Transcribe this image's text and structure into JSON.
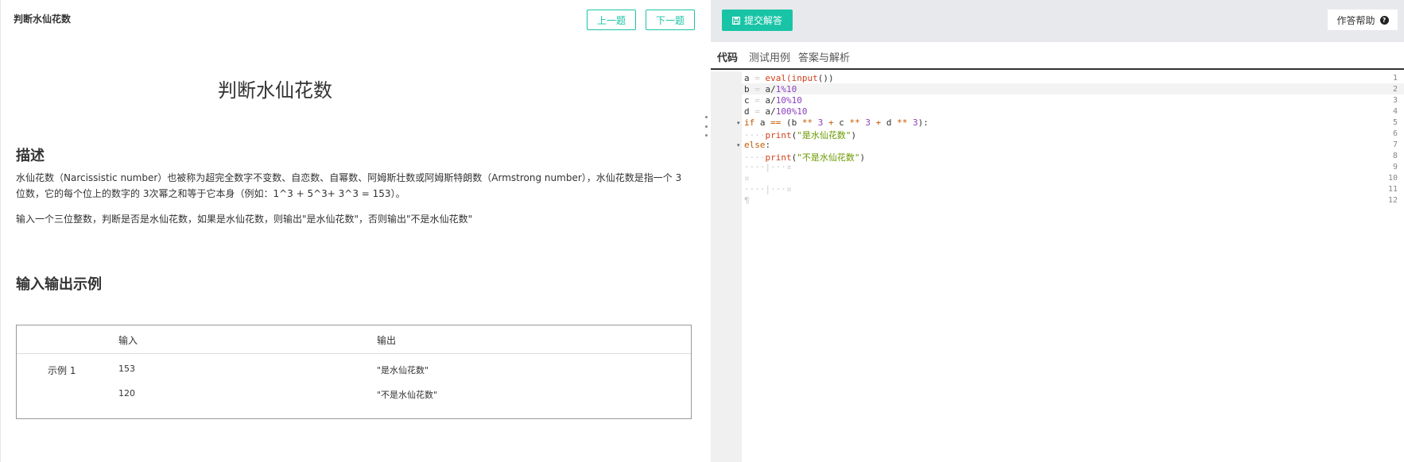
{
  "problem": {
    "header_title": "判断水仙花数",
    "prev_label": "上一题",
    "next_label": "下一题",
    "main_title": "判断水仙花数",
    "desc_heading": "描述",
    "desc_p1": "水仙花数（Narcissistic number）也被称为超完全数字不变数、自恋数、自幂数、阿姆斯壮数或阿姆斯特朗数（Armstrong number），水仙花数是指一个 3 位数，它的每个位上的数字的 3次幂之和等于它本身（例如：1^3 + 5^3+ 3^3 = 153）。",
    "desc_p2": "输入一个三位整数，判断是否是水仙花数，如果是水仙花数，则输出\"是水仙花数\"，否则输出\"不是水仙花数\"",
    "io_heading": "输入输出示例",
    "io_table": {
      "col_input": "输入",
      "col_output": "输出",
      "example_label": "示例 1",
      "rows": [
        {
          "input": "153",
          "output": "\"是水仙花数\""
        },
        {
          "input": "120",
          "output": "\"不是水仙花数\""
        }
      ]
    }
  },
  "editor_panel": {
    "submit_label": "提交解答",
    "help_label": "作答帮助",
    "help_icon": "?",
    "tabs": [
      "代码",
      "测试用例",
      "答案与解析"
    ],
    "line_numbers": [
      "1",
      "2",
      "3",
      "4",
      "5",
      "6",
      "7",
      "8",
      "9",
      "10",
      "11",
      "12"
    ],
    "code": {
      "l1": {
        "a": "a",
        "eq": " = ",
        "fn": "eval",
        "p1": "(",
        "fn2": "input",
        "p2": "())"
      },
      "l2": {
        "v": "b",
        "eq": " = ",
        "a": "a/",
        "num": "1%10"
      },
      "l3": {
        "v": "c",
        "eq": " = ",
        "a": "a/",
        "num": "10%10"
      },
      "l4": {
        "v": "d",
        "eq": " = ",
        "a": "a/",
        "num": "100%10"
      },
      "l5": {
        "kw": "if",
        "rest1": " a ",
        "op": "==",
        "rest2": " (b ",
        "op2": "**",
        "n1": " 3 ",
        "plus1": "+",
        "rest3": " c ",
        "op3": "**",
        "n2": " 3 ",
        "plus2": "+",
        "rest4": " d ",
        "op4": "**",
        "n3": " 3",
        "end": "):"
      },
      "l6": {
        "indent": "····",
        "fn": "print",
        "p": "(",
        "str": "\"是水仙花数\"",
        "pe": ")"
      },
      "l7": {
        "kw": "else",
        "end": ":"
      },
      "l8": {
        "indent": "····",
        "fn": "print",
        "p": "(",
        "str": "\"不是水仙花数\"",
        "pe": ")"
      },
      "l9": {
        "ws": "····|···¤"
      },
      "l10": {
        "ws": "¤"
      },
      "l11": {
        "ws": "····|···¤"
      },
      "l12": {
        "ws": "¶"
      }
    }
  }
}
